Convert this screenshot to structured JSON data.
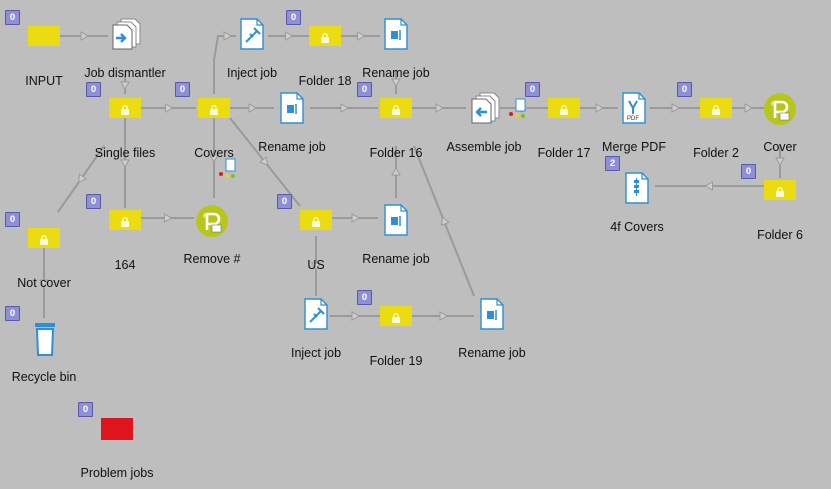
{
  "nodes": [
    {
      "id": "input",
      "label": "INPUT",
      "type": "folder",
      "badge": "0"
    },
    {
      "id": "job-dismantler",
      "label": "Job dismantler",
      "type": "dismantler"
    },
    {
      "id": "single-files",
      "label": "Single files",
      "type": "folder-locked",
      "badge": "0"
    },
    {
      "id": "covers",
      "label": "Covers",
      "type": "folder-locked",
      "badge": "0"
    },
    {
      "id": "rename-job-1",
      "label": "Rename job",
      "type": "rename"
    },
    {
      "id": "inject-job-1",
      "label": "Inject job",
      "type": "inject"
    },
    {
      "id": "folder-18",
      "label": "Folder 18",
      "type": "folder-locked",
      "badge": "0"
    },
    {
      "id": "rename-job-2",
      "label": "Rename job",
      "type": "rename"
    },
    {
      "id": "folder-16",
      "label": "Folder 16",
      "type": "folder-locked",
      "badge": "0"
    },
    {
      "id": "assemble-job",
      "label": "Assemble job",
      "type": "assemble"
    },
    {
      "id": "folder-17",
      "label": "Folder 17",
      "type": "folder-locked",
      "badge": "0"
    },
    {
      "id": "merge-pdf",
      "label": "Merge PDF",
      "type": "merge"
    },
    {
      "id": "folder-2",
      "label": "Folder 2",
      "type": "folder-locked",
      "badge": "0"
    },
    {
      "id": "cover",
      "label": "Cover",
      "type": "enfocus"
    },
    {
      "id": "folder-6",
      "label": "Folder 6",
      "type": "folder-locked",
      "badge": "0"
    },
    {
      "id": "4f-covers",
      "label": "4f Covers",
      "type": "archive",
      "badge": "2"
    },
    {
      "id": "not-cover",
      "label": "Not cover",
      "type": "folder-locked",
      "badge": "0"
    },
    {
      "id": "recycle-bin",
      "label": "Recycle bin",
      "type": "recycle",
      "badge": "0"
    },
    {
      "id": "164",
      "label": "164",
      "type": "folder-locked",
      "badge": "0"
    },
    {
      "id": "remove",
      "label": "Remove #",
      "type": "enfocus"
    },
    {
      "id": "us",
      "label": "US",
      "type": "folder-locked",
      "badge": "0"
    },
    {
      "id": "rename-job-3",
      "label": "Rename job",
      "type": "rename"
    },
    {
      "id": "inject-job-2",
      "label": "Inject job",
      "type": "inject"
    },
    {
      "id": "folder-19",
      "label": "Folder 19",
      "type": "folder-locked",
      "badge": "0"
    },
    {
      "id": "rename-job-4",
      "label": "Rename job",
      "type": "rename"
    },
    {
      "id": "problem-jobs",
      "label": "Problem jobs",
      "type": "folder-red",
      "badge": "0"
    }
  ],
  "merge_pdf_icon_text": "PDF",
  "colors": {
    "folder": "#eadc11",
    "problem": "#e0141c",
    "badge": "#8f8fd6",
    "canvas": "#bebebe",
    "edge": "#9a9a9a",
    "app_blue": "#2d8fd5",
    "enfocus": "#b8c61c"
  }
}
